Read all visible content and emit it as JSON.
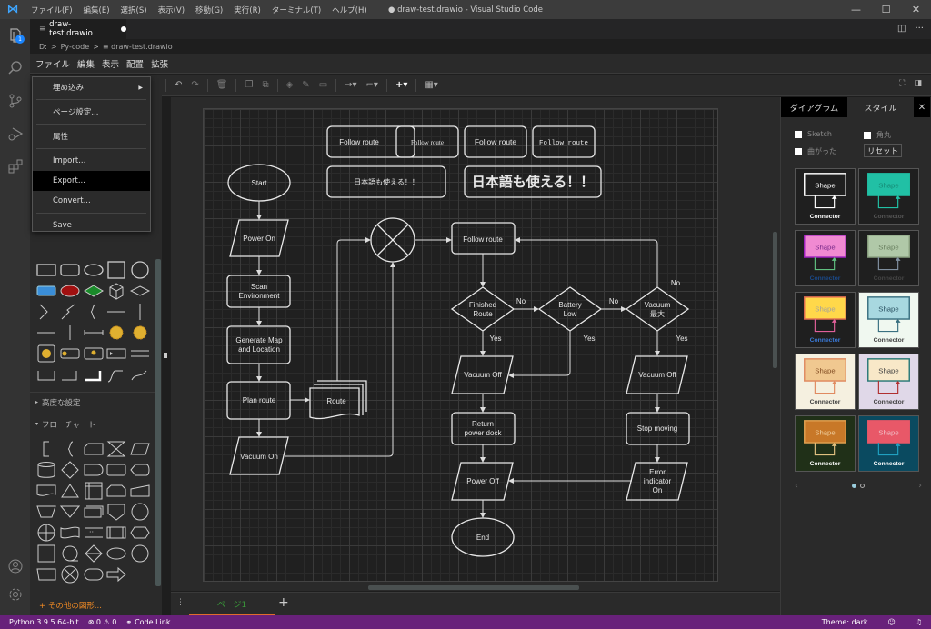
{
  "titlebar": {
    "menu": [
      "ファイル(F)",
      "編集(E)",
      "選択(S)",
      "表示(V)",
      "移動(G)",
      "実行(R)",
      "ターミナル(T)",
      "ヘルプ(H)"
    ],
    "window_title": "● draw-test.drawio - Visual Studio Code",
    "minimize": "—",
    "maximize": "☐",
    "close": "✕"
  },
  "activity_bar": {
    "explorer_badge": "1",
    "items": [
      "explorer",
      "search",
      "source-control",
      "run-debug",
      "extensions"
    ],
    "bottom": [
      "accounts",
      "settings"
    ]
  },
  "editor": {
    "tab_label": "draw-test.drawio",
    "breadcrumb": [
      "D:",
      ">",
      "Py-code",
      ">",
      "≡ draw-test.drawio"
    ]
  },
  "drawio": {
    "menu": [
      "ファイル",
      "編集",
      "表示",
      "配置",
      "拡張"
    ],
    "file_menu": [
      {
        "label": "埋め込み",
        "submenu": true
      },
      {
        "label": "ページ設定..."
      },
      {
        "label": "属性"
      },
      {
        "label": "Import..."
      },
      {
        "label": "Export...",
        "highlighted": true
      },
      {
        "label": "Convert..."
      },
      {
        "label": "Save"
      }
    ],
    "toolbar": [
      "undo",
      "redo",
      "delete",
      "to-front",
      "to-back",
      "fill-color",
      "line-color",
      "shadow",
      "connection",
      "waypoints",
      "insert",
      "table"
    ],
    "sidebar": {
      "advanced_section": "高度な設定",
      "flowchart_section": "フローチャート",
      "more_shapes": "+ その他の図形..."
    },
    "page_tab": "ページ1",
    "right_panel": {
      "tabs": [
        "ダイアグラム",
        "スタイル"
      ],
      "close": "✕",
      "checkboxes": [
        "Sketch",
        "角丸",
        "曲がった"
      ],
      "reset": "リセット",
      "themes": [
        {
          "bg": "#1f1f1f",
          "fill": "#1f1f1f",
          "stroke": "#ffffff",
          "text": "#ffffff",
          "conn": "#ffffff",
          "conn_text": "#ffffff",
          "shape_label": "Shape",
          "connector_label": "Connector"
        },
        {
          "bg": "#1f1f1f",
          "fill": "#21c0a5",
          "stroke": "#21c0a5",
          "text": "#168a75",
          "conn": "#21c0a5",
          "conn_text": "#555555",
          "shape_label": "Shape",
          "connector_label": "Connector"
        },
        {
          "bg": "#1f1f1f",
          "fill": "#f08ad2",
          "stroke": "#a020c0",
          "text": "#7a2a8a",
          "conn": "#60c080",
          "conn_text": "#1a4a8a",
          "shape_label": "Shape",
          "connector_label": "Connector"
        },
        {
          "bg": "#1f1f1f",
          "fill": "#b0c8a8",
          "stroke": "#8aa080",
          "text": "#6a8060",
          "conn": "#8090a0",
          "conn_text": "#444444",
          "shape_label": "Shape",
          "connector_label": "Connector"
        },
        {
          "bg": "#1f1f1f",
          "fill": "#ffd84a",
          "stroke": "#e06c50",
          "text": "#a0a0a0",
          "conn": "#e0609a",
          "conn_text": "#3a7ad8",
          "shape_label": "Shape",
          "connector_label": "Connector"
        },
        {
          "bg": "#f0f8f0",
          "fill": "#a8d8e0",
          "stroke": "#3a7080",
          "text": "#2a5060",
          "conn": "#3a7080",
          "conn_text": "#404040",
          "shape_label": "Shape",
          "connector_label": "Connector"
        },
        {
          "bg": "#f5f0e0",
          "fill": "#f0c890",
          "stroke": "#e08a60",
          "text": "#804a20",
          "conn": "#e08a60",
          "conn_text": "#404040",
          "shape_label": "Shape",
          "connector_label": "Connector"
        },
        {
          "bg": "#e0d8e8",
          "fill": "#f8e8c8",
          "stroke": "#2a7a78",
          "text": "#404040",
          "conn": "#b03030",
          "conn_text": "#404040",
          "shape_label": "Shape",
          "connector_label": "Connector"
        },
        {
          "bg": "#203018",
          "fill": "#c87828",
          "stroke": "#e0a050",
          "text": "#f0d0a0",
          "conn": "#e0c080",
          "conn_text": "#ffffff",
          "shape_label": "Shape",
          "connector_label": "Connector"
        },
        {
          "bg": "#0a4a60",
          "fill": "#e85868",
          "stroke": "#e85868",
          "text": "#f0c0c8",
          "conn": "#20a0c0",
          "conn_text": "#ffffff",
          "shape_label": "Shape",
          "connector_label": "Connector"
        }
      ],
      "carousel_prev": "‹",
      "carousel_next": "›"
    }
  },
  "diagram": {
    "top_boxes": [
      "Follow route",
      "Follow route",
      "Follow route",
      "Follow route"
    ],
    "jp_small": "日本語も使える！！",
    "jp_large": "日本語も使える！！",
    "nodes": {
      "start": "Start",
      "power_on": "Power On",
      "scan": "Scan Environment",
      "generate": "Generate Map and Location",
      "plan": "Plan route",
      "route_doc": "Route",
      "vacuum_on": "Vacuum On",
      "follow": "Follow route",
      "finished": "Finished Route",
      "battery": "Battery Low",
      "vacuum_max": "Vacuum 最大",
      "vac_off_1": "Vacuum Off",
      "vac_off_2": "Vacuum Off",
      "return_dock": "Return power dock",
      "stop_moving": "Stop moving",
      "power_off": "Power Off",
      "error_on": "Error indicator On",
      "end": "End"
    },
    "edge_labels": {
      "no1": "No",
      "no2": "No",
      "no3": "No",
      "yes1": "Yes",
      "yes2": "Yes",
      "yes3": "Yes"
    }
  },
  "statusbar": {
    "python": "Python 3.9.5 64-bit",
    "problems": "⊗ 0 ⚠ 0",
    "codelink": "Code Link",
    "theme": "Theme: dark",
    "feedback": "☺",
    "bell": "🔔"
  }
}
